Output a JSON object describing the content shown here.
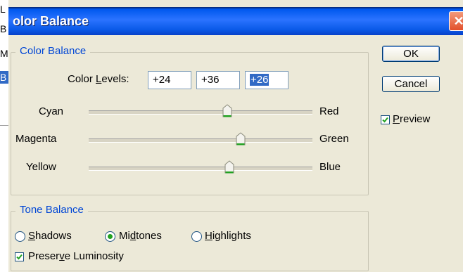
{
  "background_window": {
    "letters": [
      "L",
      "B",
      "M",
      "B"
    ]
  },
  "dialog": {
    "title": "olor Balance",
    "close_glyph": "✕"
  },
  "color_balance": {
    "legend": "Color Balance",
    "levels_label_pre": "Color ",
    "levels_label_ul": "L",
    "levels_label_post": "evels:",
    "level_1": "+24",
    "level_2": "+36",
    "level_3": "+26",
    "sliders": [
      {
        "left": "Cyan",
        "right": "Red",
        "value": 24
      },
      {
        "left": "Magenta",
        "right": "Green",
        "value": 36
      },
      {
        "left": "Yellow",
        "right": "Blue",
        "value": 26
      }
    ]
  },
  "tone_balance": {
    "legend": "Tone Balance",
    "shadows_ul": "S",
    "shadows_rest": "hadows",
    "midtones_pre": "Mi",
    "midtones_ul": "d",
    "midtones_post": "tones",
    "highlights_ul": "H",
    "highlights_rest": "ighlights",
    "selected": "Midtones",
    "preserve_pre": "Preser",
    "preserve_ul": "v",
    "preserve_post": "e Luminosity",
    "preserve_checked": true
  },
  "buttons": {
    "ok": "OK",
    "cancel": "Cancel"
  },
  "preview": {
    "ul": "P",
    "rest": "review",
    "checked": true
  },
  "colors": {
    "accent_blue": "#0046d5",
    "thumb_green": "#21a121",
    "selection": "#316ac5"
  }
}
